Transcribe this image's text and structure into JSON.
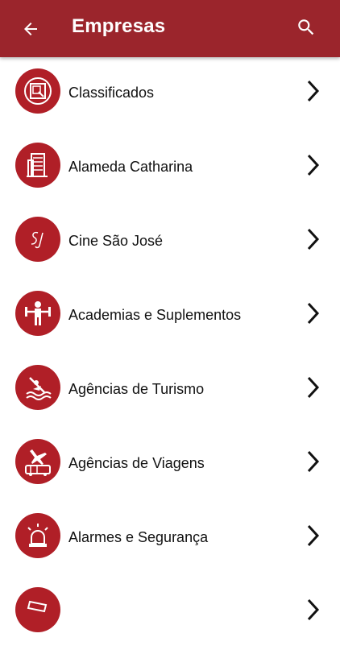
{
  "header": {
    "title": "Empresas",
    "back_icon": "arrow-back-icon",
    "search_icon": "search-icon"
  },
  "colors": {
    "appbar": "#9b252c",
    "avatar": "#b01f27",
    "text": "#111111"
  },
  "list": {
    "items": [
      {
        "label": "Classificados",
        "icon": "classifieds-icon"
      },
      {
        "label": "Alameda Catharina",
        "icon": "building-icon"
      },
      {
        "label": "Cine São José",
        "icon": "sj-monogram-icon"
      },
      {
        "label": "Academias e Suplementos",
        "icon": "weightlifter-icon"
      },
      {
        "label": "Agências de Turismo",
        "icon": "kayak-icon"
      },
      {
        "label": "Agências de Viagens",
        "icon": "plane-bus-icon"
      },
      {
        "label": "Alarmes e Segurança",
        "icon": "siren-icon"
      },
      {
        "label": "",
        "icon": "category-icon"
      }
    ]
  }
}
